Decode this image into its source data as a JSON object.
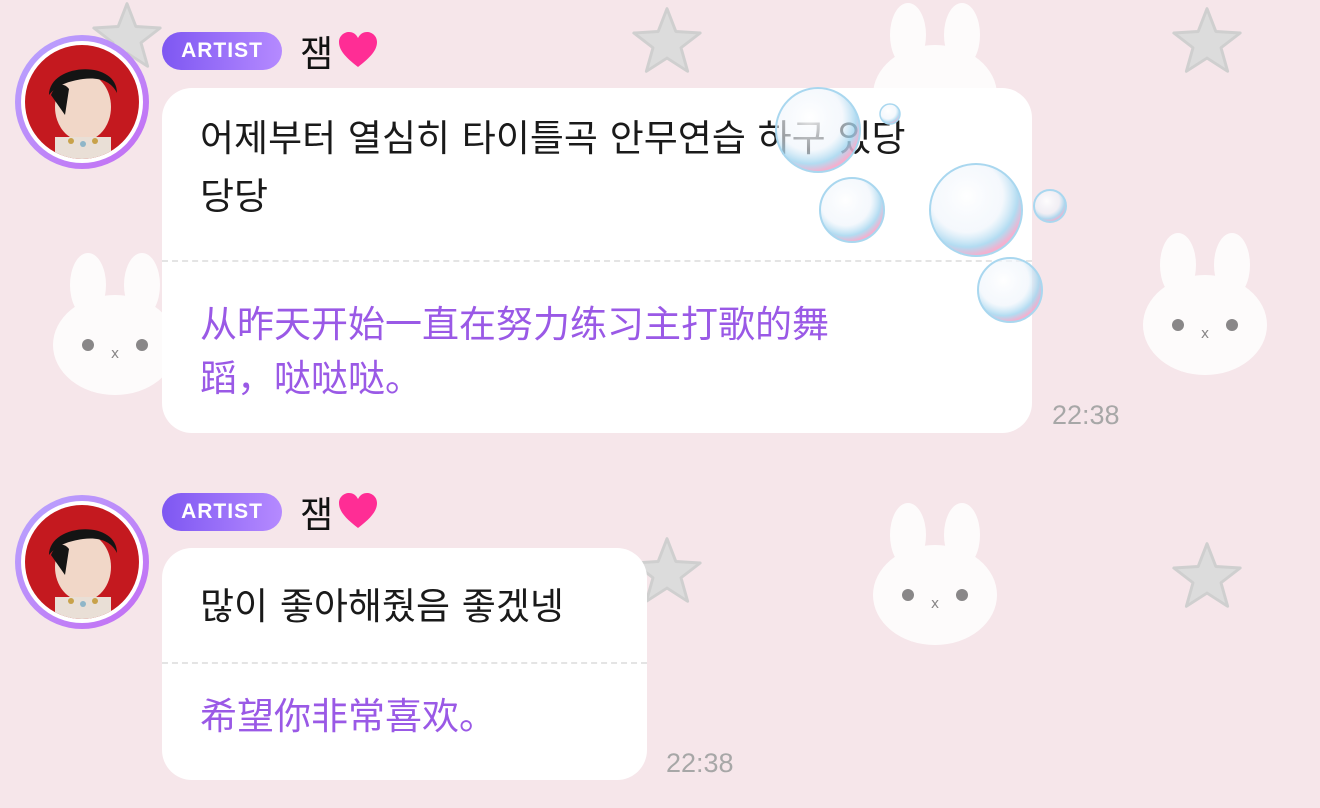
{
  "colors": {
    "background": "#f6e6ea",
    "badge_start": "#7e57f2",
    "badge_end": "#b58aff",
    "translation_text": "#9a59e6",
    "timestamp": "#a7a7a7",
    "heart": "#ff2d95"
  },
  "messages": [
    {
      "badge": "ARTIST",
      "sender": "잼",
      "sender_icon": "heart-icon",
      "korean_lines": [
        "어제부터 열심히 타이틀곡 안무연습 하구 있당",
        "당당"
      ],
      "chinese_lines": [
        "从昨天开始一直在努力练习主打歌的舞",
        "蹈，哒哒哒。"
      ],
      "time": "22:38"
    },
    {
      "badge": "ARTIST",
      "sender": "잼",
      "sender_icon": "heart-icon",
      "korean_lines": [
        "많이 좋아해줬음 좋겠넹"
      ],
      "chinese_lines": [
        "希望你非常喜欢。"
      ],
      "time": "22:38"
    }
  ]
}
